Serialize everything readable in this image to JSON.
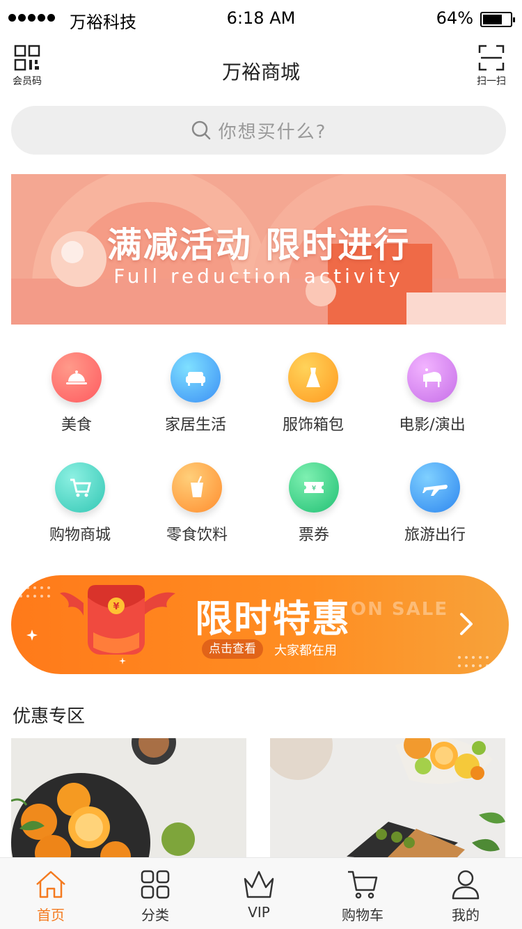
{
  "status_bar": {
    "carrier": "万裕科技",
    "time": "6:18 AM",
    "battery": "64%"
  },
  "nav": {
    "title": "万裕商城",
    "left_label": "会员码",
    "right_label": "扫一扫"
  },
  "search": {
    "placeholder": "你想买什么?"
  },
  "banner": {
    "title": "满减活动 限时进行",
    "subtitle": "Full reduction activity"
  },
  "categories": [
    {
      "label": "美食",
      "icon": "food-cloche-icon",
      "color": "#ff6b6b"
    },
    {
      "label": "家居生活",
      "icon": "sofa-icon",
      "color": "#4fb8ff"
    },
    {
      "label": "服饰箱包",
      "icon": "dress-icon",
      "color": "#ffb235"
    },
    {
      "label": "电影/演出",
      "icon": "piano-icon",
      "color": "#d88af0"
    },
    {
      "label": "购物商城",
      "icon": "cart-icon",
      "color": "#4fd6c4"
    },
    {
      "label": "零食饮料",
      "icon": "drink-cup-icon",
      "color": "#ffaa44"
    },
    {
      "label": "票券",
      "icon": "ticket-icon",
      "color": "#3fd68c"
    },
    {
      "label": "旅游出行",
      "icon": "airplane-icon",
      "color": "#3a9bf5"
    }
  ],
  "promo": {
    "title": "限时特惠",
    "ghost_text": "ON SALE",
    "pill": "点击查看",
    "note": "大家都在用",
    "accent": "#ff7a1a"
  },
  "section": {
    "title": "优惠专区"
  },
  "tabbar": {
    "active_color": "#f47a1f",
    "tabs": [
      {
        "label": "首页",
        "icon": "home-icon"
      },
      {
        "label": "分类",
        "icon": "grid-icon"
      },
      {
        "label": "VIP",
        "icon": "crown-icon"
      },
      {
        "label": "购物车",
        "icon": "cart-icon"
      },
      {
        "label": "我的",
        "icon": "user-icon"
      }
    ]
  }
}
